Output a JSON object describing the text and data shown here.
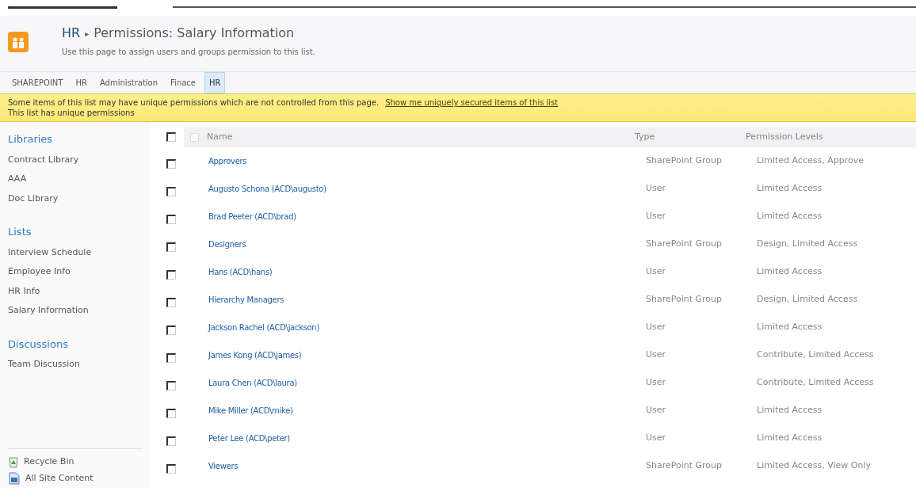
{
  "header": {
    "site": "HR",
    "separator": "▸",
    "title": "Permissions: Salary Information",
    "description": "Use this page to assign users and groups permission to this list."
  },
  "nav": [
    {
      "label": "SHAREPOINT",
      "selected": false
    },
    {
      "label": "HR",
      "selected": false
    },
    {
      "label": "Administration",
      "selected": false
    },
    {
      "label": "Finace",
      "selected": false
    },
    {
      "label": "HR",
      "selected": true
    }
  ],
  "notice": {
    "message": "Some items of this list may have unique permissions which are not controlled from this page.",
    "link": "Show me uniquely secured items of this list",
    "status": "This list has unique permissions"
  },
  "sidebar": {
    "sections": [
      {
        "heading": "Libraries",
        "items": [
          "Contract Library",
          "AAA",
          "Doc Library"
        ]
      },
      {
        "heading": "Lists",
        "items": [
          "Interview Schedule",
          "Employee Info",
          "HR Info",
          "Salary Information"
        ]
      },
      {
        "heading": "Discussions",
        "items": [
          "Team Discussion"
        ]
      }
    ],
    "footer": [
      {
        "kind": "recycle",
        "label": "Recycle Bin"
      },
      {
        "kind": "content",
        "label": "All Site Content"
      }
    ]
  },
  "table": {
    "select_all_checked": false,
    "columns": [
      "Name",
      "Type",
      "Permission Levels"
    ],
    "rows": [
      {
        "name": "Approvers",
        "type": "SharePoint Group",
        "permissions": "Limited Access, Approve",
        "checked": false
      },
      {
        "name": "Augusto Schona (ACD\\augusto)",
        "type": "User",
        "permissions": "Limited Access",
        "checked": false
      },
      {
        "name": "Brad Peeter (ACD\\brad)",
        "type": "User",
        "permissions": "Limited Access",
        "checked": false
      },
      {
        "name": "Designers",
        "type": "SharePoint Group",
        "permissions": "Design, Limited Access",
        "checked": false
      },
      {
        "name": "Hans (ACD\\hans)",
        "type": "User",
        "permissions": "Limited Access",
        "checked": false
      },
      {
        "name": "Hierarchy Managers",
        "type": "SharePoint Group",
        "permissions": "Design, Limited Access",
        "checked": false
      },
      {
        "name": "Jackson Rachel (ACD\\jackson)",
        "type": "User",
        "permissions": "Limited Access",
        "checked": false
      },
      {
        "name": "James Kong (ACD\\james)",
        "type": "User",
        "permissions": "Contribute, Limited Access",
        "checked": false
      },
      {
        "name": "Laura Chen (ACD\\laura)",
        "type": "User",
        "permissions": "Contribute, Limited Access",
        "checked": false
      },
      {
        "name": "Mike Miller (ACD\\mike)",
        "type": "User",
        "permissions": "Limited Access",
        "checked": false
      },
      {
        "name": "Peter Lee (ACD\\peter)",
        "type": "User",
        "permissions": "Limited Access",
        "checked": false
      },
      {
        "name": "Viewers",
        "type": "SharePoint Group",
        "permissions": "Limited Access, View Only",
        "checked": false
      }
    ]
  }
}
